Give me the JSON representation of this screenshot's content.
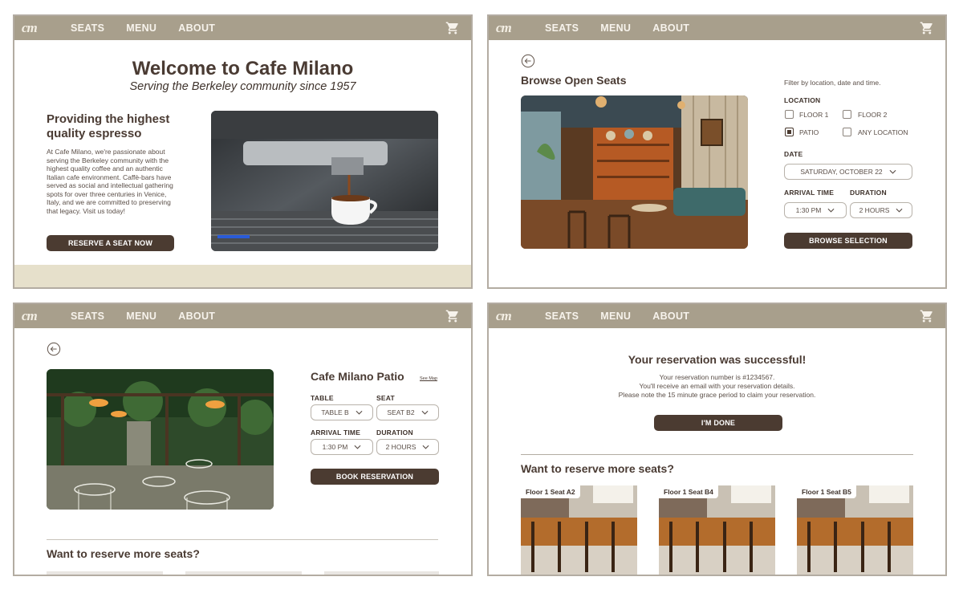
{
  "nav": {
    "logo": "cm",
    "links": [
      "SEATS",
      "MENU",
      "ABOUT"
    ]
  },
  "home": {
    "title": "Welcome to Cafe Milano",
    "subtitle": "Serving the Berkeley community since 1957",
    "heading": "Providing the highest quality espresso",
    "body": "At Cafe Milano, we're passionate about serving the Berkeley community with the highest quality coffee and an authentic Italian cafe environment. Caffè-bars have served as social and intellectual gathering spots for over three centuries in Venice, Italy, and we are committed to preserving that legacy. Visit us today!",
    "cta": "RESERVE A SEAT NOW"
  },
  "browse": {
    "title": "Browse Open Seats",
    "filter_hint": "Filter by location, date and time.",
    "location_label": "LOCATION",
    "options": [
      "FLOOR 1",
      "FLOOR 2",
      "PATIO",
      "ANY LOCATION"
    ],
    "checked": "PATIO",
    "date_label": "DATE",
    "date_value": "SATURDAY, OCTOBER 22",
    "arrival_label": "ARRIVAL TIME",
    "arrival_value": "1:30 PM",
    "duration_label": "DURATION",
    "duration_value": "2 HOURS",
    "button": "BROWSE SELECTION"
  },
  "detail": {
    "title": "Cafe Milano Patio",
    "see_map": "See Map",
    "table_label": "TABLE",
    "table_value": "TABLE B",
    "seat_label": "SEAT",
    "seat_value": "SEAT B2",
    "arrival_label": "ARRIVAL TIME",
    "arrival_value": "1:30 PM",
    "duration_label": "DURATION",
    "duration_value": "2 HOURS",
    "button": "BOOK RESERVATION",
    "more": "Want to reserve more seats?"
  },
  "success": {
    "title": "Your reservation was successful!",
    "line1": "Your reservation number is #1234567.",
    "line2": "You'll receive an email with your reservation details.",
    "line3": "Please note the 15 minute grace period to claim your reservation.",
    "button": "I'M DONE",
    "more": "Want to reserve more seats?",
    "cards": [
      "Floor 1 Seat A2",
      "Floor 1 Seat B4",
      "Floor 1 Seat B5"
    ]
  },
  "colors": {
    "nav": "#a89f8c",
    "brand_dark": "#4b3b31",
    "footer": "#e6e0cb"
  }
}
